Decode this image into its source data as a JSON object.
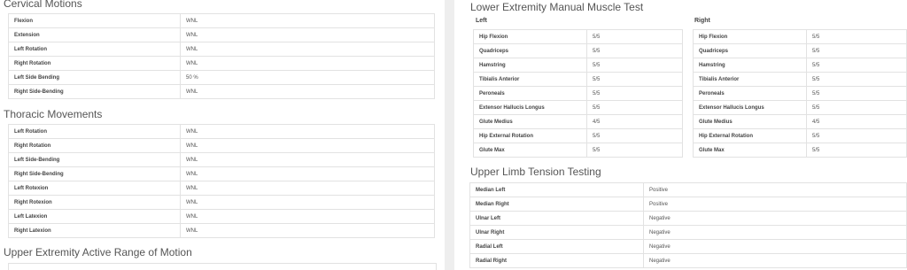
{
  "cervical": {
    "title": "Cervical Motions",
    "rows": [
      {
        "label": "Flexion",
        "value": "WNL"
      },
      {
        "label": "Extension",
        "value": "WNL"
      },
      {
        "label": "Left Rotation",
        "value": "WNL"
      },
      {
        "label": "Right Rotation",
        "value": "WNL"
      },
      {
        "label": "Left Side Bending",
        "value": "50 %"
      },
      {
        "label": "Right Side-Bending",
        "value": "WNL"
      }
    ]
  },
  "thoracic": {
    "title": "Thoracic Movements",
    "rows": [
      {
        "label": "Left Rotation",
        "value": "WNL"
      },
      {
        "label": "Right Rotation",
        "value": "WNL"
      },
      {
        "label": "Left Side-Bending",
        "value": "WNL"
      },
      {
        "label": "Right Side-Bending",
        "value": "WNL"
      },
      {
        "label": "Left Rotexion",
        "value": "WNL"
      },
      {
        "label": "Right Rotexion",
        "value": "WNL"
      },
      {
        "label": "Left Latexion",
        "value": "WNL"
      },
      {
        "label": "Right Latexion",
        "value": "WNL"
      }
    ]
  },
  "upper_rom": {
    "title": "Upper Extremity Active Range of Motion"
  },
  "lower_mmt": {
    "title": "Lower Extremity Manual Muscle Test",
    "left_label": "Left",
    "right_label": "Right",
    "left_rows": [
      {
        "label": "Hip Flexion",
        "value": "5/5"
      },
      {
        "label": "Quadriceps",
        "value": "5/5"
      },
      {
        "label": "Hamstring",
        "value": "5/5"
      },
      {
        "label": "Tibialis Anterior",
        "value": "5/5"
      },
      {
        "label": "Peroneals",
        "value": "5/5"
      },
      {
        "label": "Extensor Hallucis Longus",
        "value": "5/5"
      },
      {
        "label": "Glute Medius",
        "value": "4/5"
      },
      {
        "label": "Hip External Rotation",
        "value": "5/5"
      },
      {
        "label": "Glute Max",
        "value": "5/5"
      }
    ],
    "right_rows": [
      {
        "label": "Hip Flexion",
        "value": "5/5"
      },
      {
        "label": "Quadriceps",
        "value": "5/5"
      },
      {
        "label": "Hamstring",
        "value": "5/5"
      },
      {
        "label": "Tibialis Anterior",
        "value": "5/5"
      },
      {
        "label": "Peroneals",
        "value": "5/5"
      },
      {
        "label": "Extensor Hallucis Longus",
        "value": "5/5"
      },
      {
        "label": "Glute Medius",
        "value": "4/5"
      },
      {
        "label": "Hip External Rotation",
        "value": "5/5"
      },
      {
        "label": "Glute Max",
        "value": "5/5"
      }
    ]
  },
  "ultt": {
    "title": "Upper Limb Tension Testing",
    "rows": [
      {
        "label": "Median Left",
        "value": "Positive"
      },
      {
        "label": "Median Right",
        "value": "Positive"
      },
      {
        "label": "Ulnar Left",
        "value": "Negative"
      },
      {
        "label": "Ulnar Right",
        "value": "Negative"
      },
      {
        "label": "Radial Left",
        "value": "Negative"
      },
      {
        "label": "Radial Right",
        "value": "Negative"
      }
    ]
  }
}
